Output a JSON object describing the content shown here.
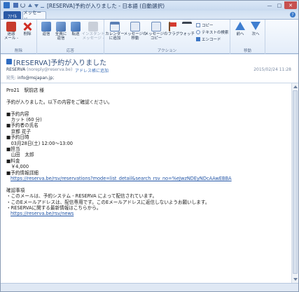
{
  "window": {
    "title": "[RESERVA]予約が入りました - 日本語 (自動選択)",
    "minimize": "—",
    "maximize": "□",
    "close": "✕"
  },
  "tabs": {
    "file": "ﾌｧｲﾙ",
    "message": "メッセージ",
    "help": "?"
  },
  "ribbon": {
    "delete_group": {
      "label": "削除",
      "delete_menu": "迷惑\nメール -",
      "delete": "削除"
    },
    "reply_group": {
      "label": "応答",
      "reply": "返信",
      "reply_all": "全員に\n返信",
      "forward": "転送\n-",
      "im": "インスタント\nメッセージ -"
    },
    "action_group": {
      "label": "アクション",
      "add_calendar": "カレンダー\nに追加",
      "move": "メッセージの\n移動",
      "copy_msg": "メッセージの\nコピー",
      "flag": "フラグ",
      "watch": "ウォッチ",
      "copy_small": "コピー",
      "text_search": "テキストの検索",
      "encode": "エンコード"
    },
    "move_group": {
      "label": "移動",
      "prev": "前へ",
      "next": "次へ"
    }
  },
  "header": {
    "subject": "[RESERVA]予約が入りました",
    "from_name": "RESERVA",
    "from_email": "(noreply@reserva.be)",
    "add_address": "アドレス帳に追加",
    "date": "2015/02/24 11:28",
    "to_label": "宛先:",
    "to": "info@msjapan.jp;"
  },
  "body": {
    "lines": [
      "Pro21　駅前店 様",
      "",
      "予約が入りました。以下の内容をご確認ください。",
      "",
      "■予約内容",
      "　カット (60 分)",
      "■予約者の氏名",
      "　京都 花子",
      "■予約日時",
      "　03月28日(土) 12:00～13:00",
      "■担当",
      "　山田　太郎",
      "■料金",
      "　￥4,000",
      "■予約情報詳細"
    ],
    "link1": "https://reserva.be/rsv/reservations?mode=list_detail&search_rsv_no=%eJwzNDEyNDcAAwEBBA",
    "lines2": [
      "",
      "確認事項",
      "・このメールは、予約システム - RESERVA によって配信されています。",
      "・このEメールアドレスは、配信専用です。このEメールアドレスに返信しないようお願いします。",
      "・RESERVAに関する最新情報はこちらから。"
    ],
    "link2": "https://reserva.be/rsv/news"
  }
}
